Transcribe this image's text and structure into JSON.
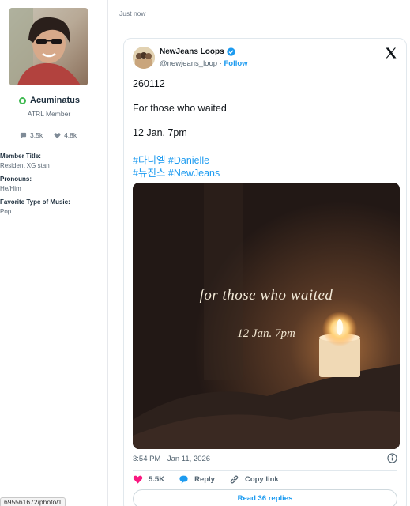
{
  "profile": {
    "username": "Acuminatus",
    "user_title": "ATRL Member",
    "messages": "3.5k",
    "reactions": "4.8k",
    "fields": [
      {
        "label": "Member Title:",
        "value": "Resident XG stan"
      },
      {
        "label": "Pronouns:",
        "value": "He/Him"
      },
      {
        "label": "Favorite Type of Music:",
        "value": "Pop"
      }
    ]
  },
  "post": {
    "timestamp": "Just now"
  },
  "tweet": {
    "display_name": "NewJeans Loops",
    "handle": "@newjeans_loop",
    "separator": " · ",
    "follow_label": "Follow",
    "lines": [
      "260112",
      "For those who waited",
      "12 Jan. 7pm"
    ],
    "hashtags_line1": "#다니엘 #Danielle",
    "hashtags_line2": "#뉴진스 #NewJeans",
    "media_text_1": "for those who waited",
    "media_text_2": "12 Jan. 7pm",
    "datetime": "3:54 PM · Jan 11, 2026",
    "like_count": "5.5K",
    "reply_label": "Reply",
    "copy_link_label": "Copy link",
    "read_replies_label": "Read 36 replies"
  },
  "status_bar_url": "695561672/photo/1",
  "colors": {
    "accent": "#1d9bf0",
    "like": "#f91880",
    "online": "#3fb950"
  },
  "icons": [
    "online-status-icon",
    "message-icon",
    "heart-icon",
    "verified-badge-icon",
    "x-logo-icon",
    "info-icon",
    "like-heart-icon",
    "reply-bubble-icon",
    "copy-link-icon"
  ]
}
